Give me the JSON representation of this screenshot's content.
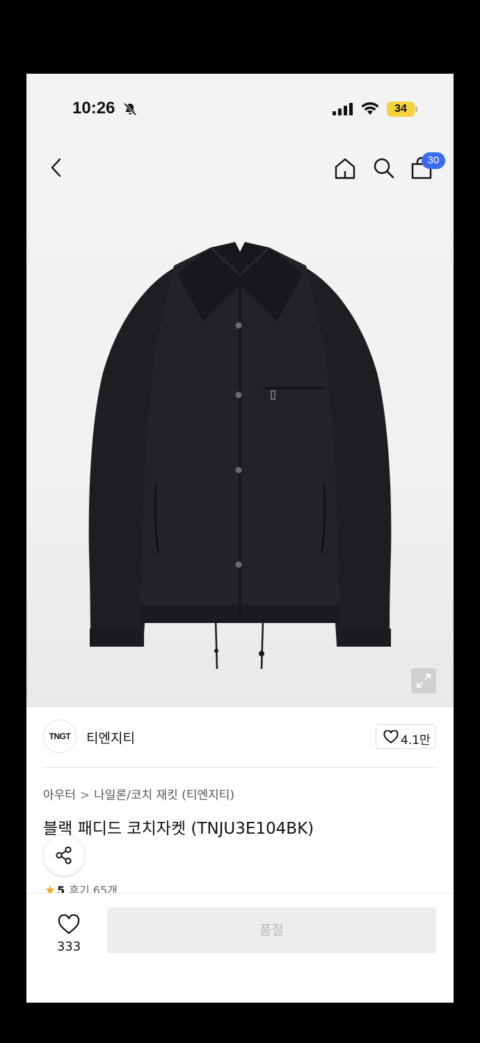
{
  "status_bar": {
    "time": "10:26",
    "battery": "34"
  },
  "nav": {
    "cart_count": "30"
  },
  "brand": {
    "logo_text": "TNGT",
    "name": "티엔지티",
    "like_count": "4.1만"
  },
  "breadcrumb": {
    "category": "아우터",
    "separator": ">",
    "subcategory": "나일론/코치 재킷 (티엔지티)"
  },
  "product": {
    "title": "블랙 패디드 코치자켓 (TNJU3E104BK)",
    "rating": "5",
    "reviews": "후기 65개"
  },
  "bottom_bar": {
    "wish_count": "333",
    "soldout_label": "품절"
  },
  "colors": {
    "accent_badge": "#3a6bf0",
    "battery_badge": "#f5d33c",
    "star": "#f5a623"
  }
}
